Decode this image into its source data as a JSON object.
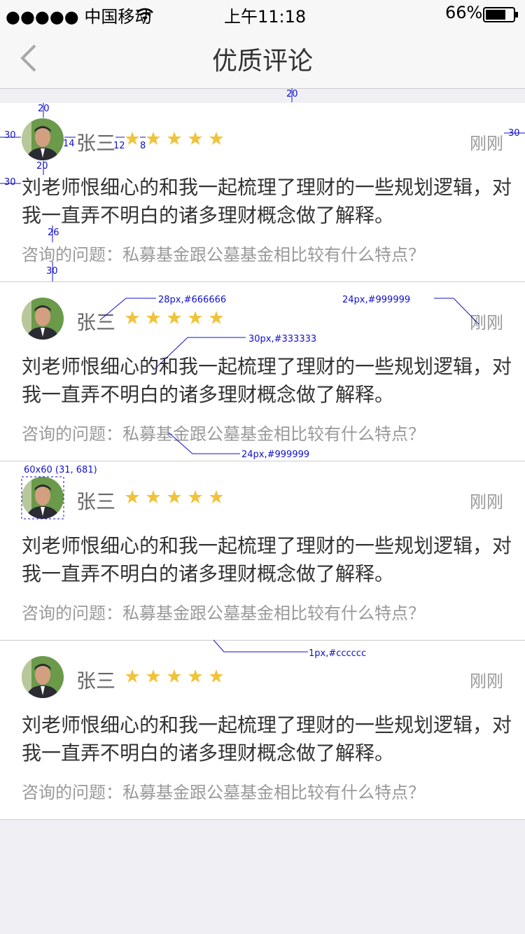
{
  "status_bar": {
    "carrier": "●●●●● 中国移动",
    "time": "上午11:18",
    "battery": "66%"
  },
  "nav": {
    "title": "优质评论",
    "back_icon": "chevron-left-icon"
  },
  "comments": [
    {
      "name": "张三",
      "rating": 5,
      "time": "刚刚",
      "content": "刘老师恨细心的和我一起梳理了理财的一些规划逻辑，对我一直弄不明白的诸多理财概念做了解释。",
      "question": "咨询的问题：私募基金跟公墓基金相比较有什么特点？"
    },
    {
      "name": "张三",
      "rating": 5,
      "time": "刚刚",
      "content": "刘老师恨细心的和我一起梳理了理财的一些规划逻辑，对我一直弄不明白的诸多理财概念做了解释。",
      "question": "咨询的问题：私募基金跟公墓基金相比较有什么特点？"
    },
    {
      "name": "张三",
      "rating": 5,
      "time": "刚刚",
      "content": "刘老师恨细心的和我一起梳理了理财的一些规划逻辑，对我一直弄不明白的诸多理财概念做了解释。",
      "question": "咨询的问题：私募基金跟公墓基金相比较有什么特点？"
    },
    {
      "name": "张三",
      "rating": 5,
      "time": "刚刚",
      "content": "刘老师恨细心的和我一起梳理了理财的一些规划逻辑，对我一直弄不明白的诸多理财概念做了解释。",
      "question": "咨询的问题：私募基金跟公墓基金相比较有什么特点？"
    }
  ],
  "annotations": {
    "gap_top": "20",
    "avatar_top": "20",
    "left_pad": "30",
    "name_gap": "14",
    "star_gap": "12",
    "star_spacing": "8",
    "right_pad": "30",
    "avatar_bottom": "20",
    "content_left": "30",
    "content_gap": "26",
    "bottom_pad": "30",
    "name_spec": "28px,#666666",
    "time_spec": "24px,#999999",
    "content_spec": "30px,#333333",
    "question_spec": "24px,#999999",
    "avatar_spec": "60x60 (31, 681)",
    "divider_spec": "1px,#cccccc"
  },
  "colors": {
    "star": "#f0c33c",
    "divider": "#cccccc",
    "annotation": "#1010d0"
  }
}
